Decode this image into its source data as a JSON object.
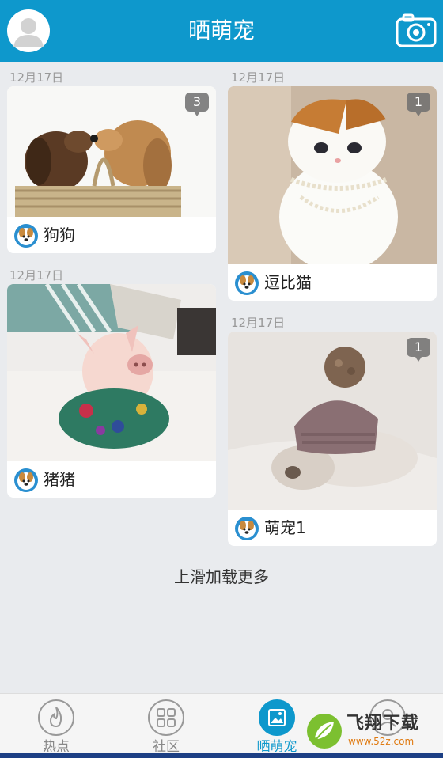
{
  "header": {
    "title": "晒萌宠",
    "avatar_icon": "user-avatar-icon",
    "camera_icon": "camera-icon",
    "color": "#0e98cc"
  },
  "posts": [
    {
      "date": "12月17日",
      "name": "狗狗",
      "comments": "3",
      "photo": "two-puppies-in-basket"
    },
    {
      "date": "12月17日",
      "name": "逗比猫",
      "comments": "1",
      "photo": "white-cat-with-pearls"
    },
    {
      "date": "12月17日",
      "name": "猪猪",
      "comments": "",
      "photo": "piglet-in-floral-shirt"
    },
    {
      "date": "12月17日",
      "name": "萌宠1",
      "comments": "1",
      "photo": "bunny-wearing-knit-hat"
    }
  ],
  "load_more": "上滑加载更多",
  "bottom_nav": [
    {
      "label": "热点",
      "icon": "flame-icon",
      "active": false
    },
    {
      "label": "社区",
      "icon": "grid-icon",
      "active": false
    },
    {
      "label": "晒萌宠",
      "icon": "photo-icon",
      "active": true
    },
    {
      "label": "",
      "icon": "profile-icon",
      "active": false
    }
  ],
  "watermark": {
    "title": "飞翔下载",
    "url": "www.52z.com"
  }
}
